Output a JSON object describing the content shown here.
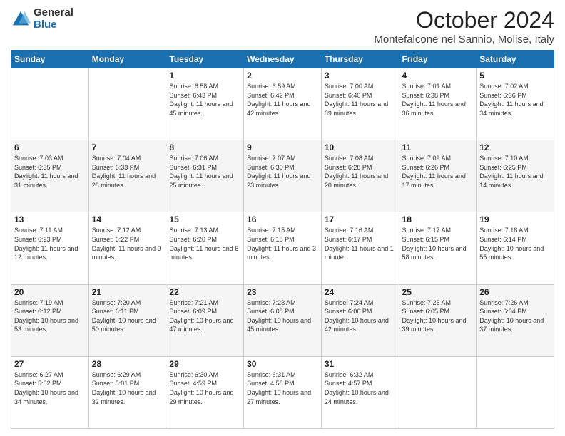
{
  "logo": {
    "general": "General",
    "blue": "Blue"
  },
  "header": {
    "month": "October 2024",
    "location": "Montefalcone nel Sannio, Molise, Italy"
  },
  "weekdays": [
    "Sunday",
    "Monday",
    "Tuesday",
    "Wednesday",
    "Thursday",
    "Friday",
    "Saturday"
  ],
  "weeks": [
    [
      {
        "day": "",
        "info": ""
      },
      {
        "day": "",
        "info": ""
      },
      {
        "day": "1",
        "info": "Sunrise: 6:58 AM\nSunset: 6:43 PM\nDaylight: 11 hours and 45 minutes."
      },
      {
        "day": "2",
        "info": "Sunrise: 6:59 AM\nSunset: 6:42 PM\nDaylight: 11 hours and 42 minutes."
      },
      {
        "day": "3",
        "info": "Sunrise: 7:00 AM\nSunset: 6:40 PM\nDaylight: 11 hours and 39 minutes."
      },
      {
        "day": "4",
        "info": "Sunrise: 7:01 AM\nSunset: 6:38 PM\nDaylight: 11 hours and 36 minutes."
      },
      {
        "day": "5",
        "info": "Sunrise: 7:02 AM\nSunset: 6:36 PM\nDaylight: 11 hours and 34 minutes."
      }
    ],
    [
      {
        "day": "6",
        "info": "Sunrise: 7:03 AM\nSunset: 6:35 PM\nDaylight: 11 hours and 31 minutes."
      },
      {
        "day": "7",
        "info": "Sunrise: 7:04 AM\nSunset: 6:33 PM\nDaylight: 11 hours and 28 minutes."
      },
      {
        "day": "8",
        "info": "Sunrise: 7:06 AM\nSunset: 6:31 PM\nDaylight: 11 hours and 25 minutes."
      },
      {
        "day": "9",
        "info": "Sunrise: 7:07 AM\nSunset: 6:30 PM\nDaylight: 11 hours and 23 minutes."
      },
      {
        "day": "10",
        "info": "Sunrise: 7:08 AM\nSunset: 6:28 PM\nDaylight: 11 hours and 20 minutes."
      },
      {
        "day": "11",
        "info": "Sunrise: 7:09 AM\nSunset: 6:26 PM\nDaylight: 11 hours and 17 minutes."
      },
      {
        "day": "12",
        "info": "Sunrise: 7:10 AM\nSunset: 6:25 PM\nDaylight: 11 hours and 14 minutes."
      }
    ],
    [
      {
        "day": "13",
        "info": "Sunrise: 7:11 AM\nSunset: 6:23 PM\nDaylight: 11 hours and 12 minutes."
      },
      {
        "day": "14",
        "info": "Sunrise: 7:12 AM\nSunset: 6:22 PM\nDaylight: 11 hours and 9 minutes."
      },
      {
        "day": "15",
        "info": "Sunrise: 7:13 AM\nSunset: 6:20 PM\nDaylight: 11 hours and 6 minutes."
      },
      {
        "day": "16",
        "info": "Sunrise: 7:15 AM\nSunset: 6:18 PM\nDaylight: 11 hours and 3 minutes."
      },
      {
        "day": "17",
        "info": "Sunrise: 7:16 AM\nSunset: 6:17 PM\nDaylight: 11 hours and 1 minute."
      },
      {
        "day": "18",
        "info": "Sunrise: 7:17 AM\nSunset: 6:15 PM\nDaylight: 10 hours and 58 minutes."
      },
      {
        "day": "19",
        "info": "Sunrise: 7:18 AM\nSunset: 6:14 PM\nDaylight: 10 hours and 55 minutes."
      }
    ],
    [
      {
        "day": "20",
        "info": "Sunrise: 7:19 AM\nSunset: 6:12 PM\nDaylight: 10 hours and 53 minutes."
      },
      {
        "day": "21",
        "info": "Sunrise: 7:20 AM\nSunset: 6:11 PM\nDaylight: 10 hours and 50 minutes."
      },
      {
        "day": "22",
        "info": "Sunrise: 7:21 AM\nSunset: 6:09 PM\nDaylight: 10 hours and 47 minutes."
      },
      {
        "day": "23",
        "info": "Sunrise: 7:23 AM\nSunset: 6:08 PM\nDaylight: 10 hours and 45 minutes."
      },
      {
        "day": "24",
        "info": "Sunrise: 7:24 AM\nSunset: 6:06 PM\nDaylight: 10 hours and 42 minutes."
      },
      {
        "day": "25",
        "info": "Sunrise: 7:25 AM\nSunset: 6:05 PM\nDaylight: 10 hours and 39 minutes."
      },
      {
        "day": "26",
        "info": "Sunrise: 7:26 AM\nSunset: 6:04 PM\nDaylight: 10 hours and 37 minutes."
      }
    ],
    [
      {
        "day": "27",
        "info": "Sunrise: 6:27 AM\nSunset: 5:02 PM\nDaylight: 10 hours and 34 minutes."
      },
      {
        "day": "28",
        "info": "Sunrise: 6:29 AM\nSunset: 5:01 PM\nDaylight: 10 hours and 32 minutes."
      },
      {
        "day": "29",
        "info": "Sunrise: 6:30 AM\nSunset: 4:59 PM\nDaylight: 10 hours and 29 minutes."
      },
      {
        "day": "30",
        "info": "Sunrise: 6:31 AM\nSunset: 4:58 PM\nDaylight: 10 hours and 27 minutes."
      },
      {
        "day": "31",
        "info": "Sunrise: 6:32 AM\nSunset: 4:57 PM\nDaylight: 10 hours and 24 minutes."
      },
      {
        "day": "",
        "info": ""
      },
      {
        "day": "",
        "info": ""
      }
    ]
  ]
}
